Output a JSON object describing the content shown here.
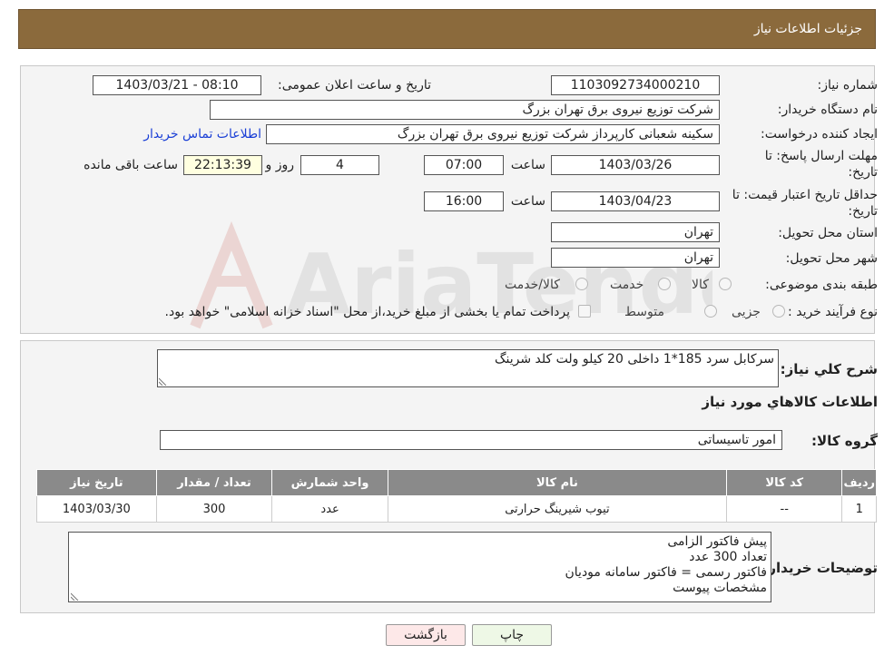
{
  "header": {
    "title": "جزئیات اطلاعات نیاز"
  },
  "form": {
    "need_number_label": "شماره نیاز:",
    "need_number": "1103092734000210",
    "announce_label": "تاریخ و ساعت اعلان عمومی:",
    "announce_value": "1403/03/21 - 08:10",
    "buyer_org_label": "نام دستگاه خریدار:",
    "buyer_org": "شرکت توزیع نیروی برق تهران بزرگ",
    "creator_label": "ایجاد کننده درخواست:",
    "creator": "سکینه شعبانی کارپرداز شرکت توزیع نیروی برق تهران بزرگ",
    "contact_link": "اطلاعات تماس خریدار",
    "deadline_label_1": "مهلت ارسال پاسخ: تا",
    "deadline_label_2": "تاریخ:",
    "deadline_date": "1403/03/26",
    "time_label": "ساعت",
    "deadline_time": "07:00",
    "days_value": "4",
    "days_label": "روز و",
    "remaining_time": "22:13:39",
    "remaining_label": "ساعت باقی مانده",
    "validity_label_1": "حداقل تاریخ اعتبار قیمت: تا",
    "validity_label_2": "تاریخ:",
    "validity_date": "1403/04/23",
    "validity_time": "16:00",
    "province_label": "استان محل تحویل:",
    "province": "تهران",
    "city_label": "شهر محل تحویل:",
    "city": "تهران",
    "category_label": "طبقه بندی موضوعی:",
    "category_options": [
      "کالا",
      "خدمت",
      "کالا/خدمت"
    ],
    "purchase_label": "نوع فرآیند خرید :",
    "purchase_options": [
      "جزیی",
      "متوسط"
    ],
    "purchase_note": "پرداخت تمام یا بخشی از مبلغ خرید،از محل \"اسناد خزانه اسلامی\" خواهد بود."
  },
  "summary": {
    "desc_label": "شرح کلي نیاز:",
    "description": "سرکابل سرد 185*1 داخلی 20 کیلو ولت کلد شرینگ",
    "goods_info_title": "اطلاعات کالاهاي مورد نیاز",
    "group_label": "گروه کالا:",
    "group_value": "امور تاسیساتی"
  },
  "table": {
    "headers": [
      "ردیف",
      "کد کالا",
      "نام کالا",
      "واحد شمارش",
      "تعداد / مقدار",
      "تاریخ نیاز"
    ],
    "rows": [
      [
        "1",
        "--",
        "تیوب شیرینگ حرارتی",
        "عدد",
        "300",
        "1403/03/30"
      ]
    ]
  },
  "notes": {
    "label": "توضیحات خریدار:",
    "lines": [
      "پیش فاکتور الزامی",
      "تعداد 300 عدد",
      "فاکتور رسمی = فاکتور سامانه مودیان",
      "مشخصات پیوست"
    ]
  },
  "buttons": {
    "print": "چاپ",
    "back": "بازگشت"
  },
  "watermark": {
    "text": "AriaTender.neT"
  },
  "colors": {
    "header_bg": "#8b6a3c",
    "table_header_bg": "#8a8a8a",
    "link": "#1a3fd6",
    "back_bg": "#fde8e8",
    "print_bg": "#eef8e6"
  }
}
